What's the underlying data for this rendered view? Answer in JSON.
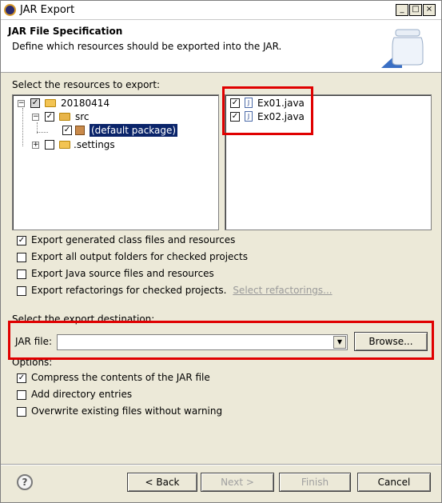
{
  "window": {
    "title": "JAR Export"
  },
  "header": {
    "title": "JAR File Specification",
    "description": "Define which resources should be exported into the JAR."
  },
  "resources": {
    "label": "Select the resources to export:",
    "tree": [
      {
        "label": "20180414",
        "checked": "partial",
        "expanded": true
      },
      {
        "label": "src",
        "checked": "checked",
        "expanded": true
      },
      {
        "label": "(default package)",
        "checked": "checked",
        "selected": true
      },
      {
        "label": ".settings",
        "checked": "unchecked",
        "expanded": false
      }
    ],
    "files": [
      {
        "label": "Ex01.java",
        "checked": "checked"
      },
      {
        "label": "Ex02.java",
        "checked": "checked"
      }
    ]
  },
  "export_options": [
    {
      "label": "Export generated class files and resources",
      "checked": true
    },
    {
      "label": "Export all output folders for checked projects",
      "checked": false
    },
    {
      "label": "Export Java source files and resources",
      "checked": false
    },
    {
      "label": "Export refactorings for checked projects.",
      "checked": false,
      "link": "Select refactorings..."
    }
  ],
  "destination": {
    "label": "Select the export destination:",
    "jar_label": "JAR file:",
    "jar_value": "",
    "browse_label": "Browse..."
  },
  "options": {
    "label": "Options:",
    "items": [
      {
        "label": "Compress the contents of the JAR file",
        "checked": true
      },
      {
        "label": "Add directory entries",
        "checked": false
      },
      {
        "label": "Overwrite existing files without warning",
        "checked": false
      }
    ]
  },
  "buttons": {
    "help": "?",
    "back": "< Back",
    "next": "Next >",
    "finish": "Finish",
    "cancel": "Cancel"
  },
  "colors": {
    "highlight_box": "#e00000",
    "selection": "#0a246a"
  }
}
